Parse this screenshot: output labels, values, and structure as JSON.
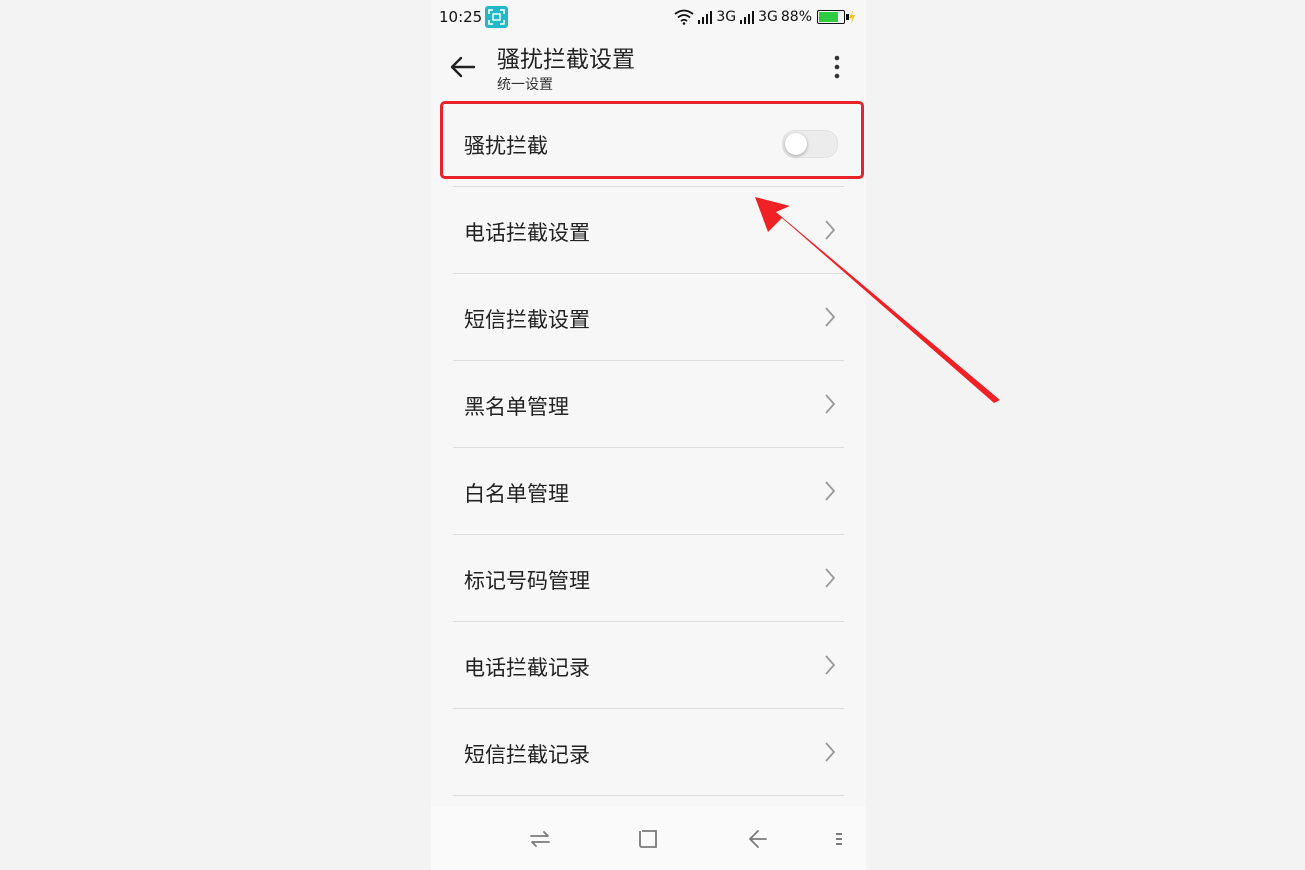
{
  "status_bar": {
    "time": "10:25",
    "signal_1": "3G",
    "signal_2": "3G",
    "battery_percent": "88%",
    "battery_level": 0.88,
    "icons": [
      "screenshot-icon",
      "wifi-icon",
      "signal-icon",
      "battery-icon",
      "charging-icon"
    ]
  },
  "header": {
    "title": "骚扰拦截设置",
    "subtitle": "统一设置"
  },
  "list": {
    "toggle_item": {
      "label": "骚扰拦截",
      "enabled": false
    },
    "items": [
      {
        "label": "电话拦截设置"
      },
      {
        "label": "短信拦截设置"
      },
      {
        "label": "黑名单管理"
      },
      {
        "label": "白名单管理"
      },
      {
        "label": "标记号码管理"
      },
      {
        "label": "电话拦截记录"
      },
      {
        "label": "短信拦截记录"
      }
    ]
  },
  "nav_bar": {
    "icons": [
      "switch-apps-icon",
      "home-square-icon",
      "back-icon",
      "menu-icon"
    ]
  },
  "annotation": {
    "highlight_color": "#e8232a",
    "arrow_color": "#f02025"
  }
}
